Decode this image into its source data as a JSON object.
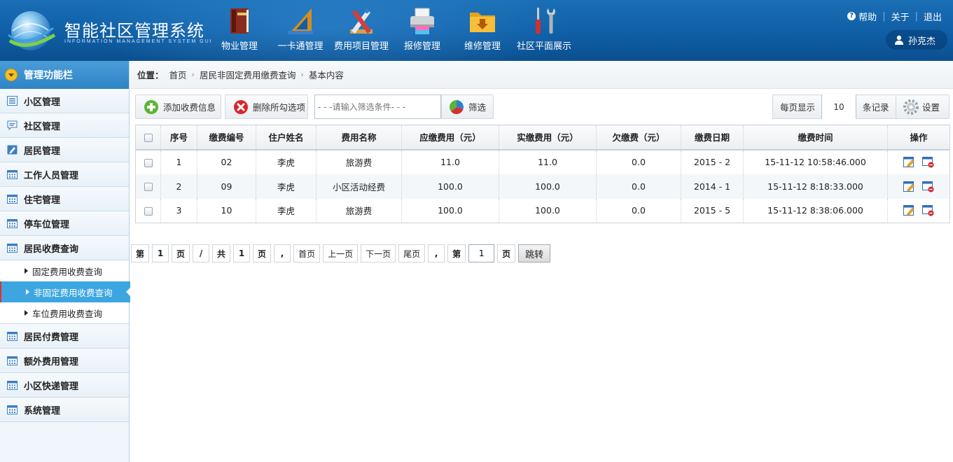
{
  "header": {
    "title": "智能社区管理系统",
    "subtitle": "INFORMATION MANAGEMENT SYSTEM GUI",
    "nav": [
      {
        "label": "物业管理",
        "icon": "book-icon"
      },
      {
        "label": "一卡通管理",
        "icon": "ruler-triangle-icon"
      },
      {
        "label": "费用项目管理",
        "icon": "pencil-tools-icon"
      },
      {
        "label": "报修管理",
        "icon": "printer-icon"
      },
      {
        "label": "维修管理",
        "icon": "folder-download-icon"
      },
      {
        "label": "社区平面展示",
        "icon": "wrench-screwdriver-icon"
      }
    ],
    "links": {
      "help": "帮助",
      "about": "关于",
      "logout": "退出"
    },
    "user": "孙克杰"
  },
  "sidebar": {
    "title": "管理功能栏",
    "items_top": [
      {
        "label": "小区管理",
        "icon": "list-icon"
      },
      {
        "label": "社区管理",
        "icon": "chat-icon"
      },
      {
        "label": "居民管理",
        "icon": "edit-icon"
      },
      {
        "label": "工作人员管理",
        "icon": "calendar-icon"
      },
      {
        "label": "住宅管理",
        "icon": "calendar-icon"
      },
      {
        "label": "停车位管理",
        "icon": "calendar-icon"
      },
      {
        "label": "居民收费查询",
        "icon": "calendar-icon"
      }
    ],
    "sub_items": [
      "固定费用收费查询",
      "非固定费用收费查询",
      "车位费用收费查询"
    ],
    "active_sub": 1,
    "items_bottom": [
      {
        "label": "居民付费管理",
        "icon": "calendar-icon"
      },
      {
        "label": "额外费用管理",
        "icon": "calendar-icon"
      },
      {
        "label": "小区快递管理",
        "icon": "calendar-icon"
      },
      {
        "label": "系统管理",
        "icon": "calendar-icon"
      }
    ]
  },
  "breadcrumb": {
    "label": "位置：",
    "items": [
      "首页",
      "居民非固定费用缴费查询",
      "基本内容"
    ]
  },
  "toolbar": {
    "add_label": "添加收费信息",
    "delete_label": "删除所勾选项",
    "filter_placeholder": "- - -请输入筛选条件- - -",
    "filter_label": "筛选",
    "per_page_label": "每页显示",
    "per_page_value": "10",
    "per_page_unit": "条记录",
    "settings_label": "设置"
  },
  "table": {
    "columns": [
      "序号",
      "缴费编号",
      "住户姓名",
      "费用名称",
      "应缴费用（元）",
      "实缴费用（元）",
      "欠缴费（元）",
      "缴费日期",
      "缴费时间",
      "操作"
    ],
    "rows": [
      [
        "1",
        "02",
        "李虎",
        "旅游费",
        "11.0",
        "11.0",
        "0.0",
        "2015 - 2",
        "15-11-12 10:58:46.000"
      ],
      [
        "2",
        "09",
        "李虎",
        "小区活动经费",
        "100.0",
        "100.0",
        "0.0",
        "2014 - 1",
        "15-11-12 8:18:33.000"
      ],
      [
        "3",
        "10",
        "李虎",
        "旅游费",
        "100.0",
        "100.0",
        "0.0",
        "2015 - 5",
        "15-11-12 8:38:06.000"
      ]
    ]
  },
  "pager": {
    "page_prefix": "第",
    "current_page": "1",
    "page_suffix": "页",
    "slash": "/",
    "total_prefix": "共",
    "total_pages": "1",
    "total_suffix": "页",
    "comma": ",",
    "first": "首页",
    "prev": "上一页",
    "next": "下一页",
    "last": "尾页",
    "goto_prefix": "第",
    "goto_value": "1",
    "goto_suffix": "页",
    "jump": "跳转"
  }
}
